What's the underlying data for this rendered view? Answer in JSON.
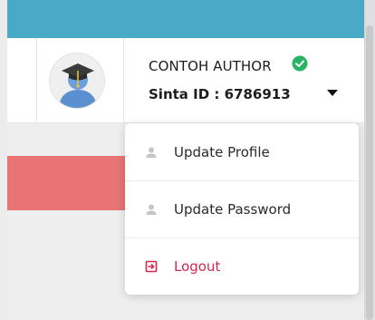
{
  "header": {
    "user_name": "CONTOH AUTHOR",
    "sinta_id": "Sinta ID : 6786913",
    "verified_icon": "check-circle-icon",
    "avatar_icon": "graduate-avatar-icon",
    "caret_icon": "caret-down-icon"
  },
  "dropdown": {
    "items": [
      {
        "label": "Update Profile",
        "icon": "user-icon"
      },
      {
        "label": "Update Password",
        "icon": "user-icon"
      },
      {
        "label": "Logout",
        "icon": "logout-icon"
      }
    ]
  },
  "colors": {
    "topbar": "#4aa9c7",
    "verified": "#28b463",
    "logout": "#d6264f",
    "banner": "#e87474"
  }
}
